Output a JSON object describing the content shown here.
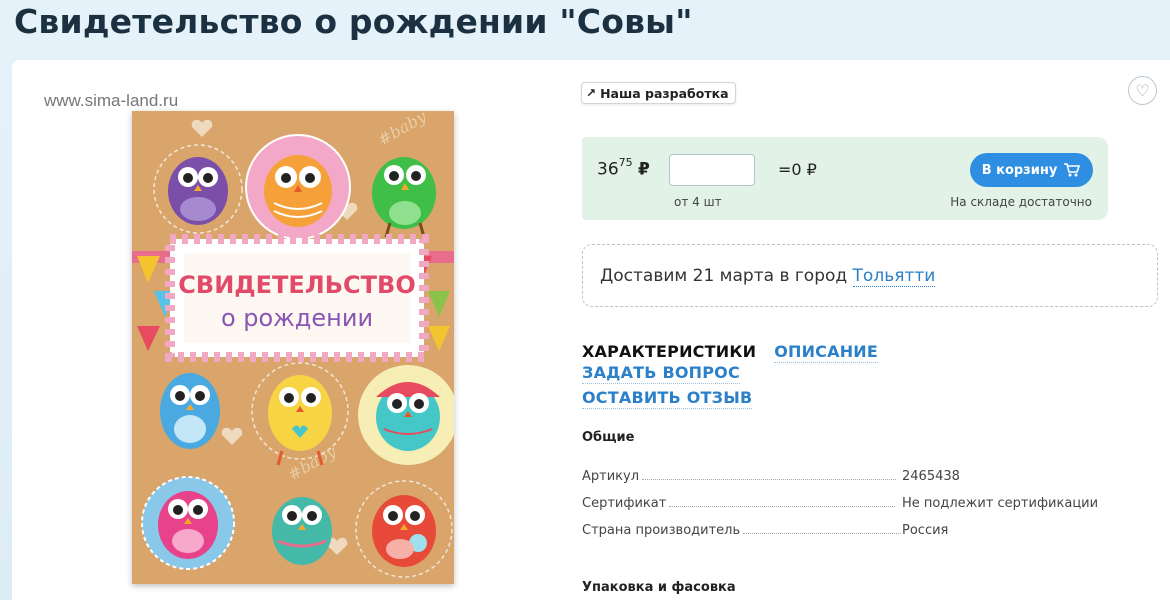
{
  "page": {
    "title": "Свидетельство о рождении \"Совы\"",
    "watermark": "www.sima-land.ru"
  },
  "image": {
    "card_title_line1": "СВИДЕТЕЛЬСТВО",
    "card_title_line2": "о рождении",
    "baby_text": "#baby"
  },
  "badge": {
    "icon": "arrow-curve-icon",
    "label": "Наша разработка"
  },
  "favorite": {
    "icon": "heart-icon"
  },
  "buy": {
    "price_main": "36",
    "price_cents": "75",
    "currency": "₽",
    "quantity_value": "",
    "total": "=0 ₽",
    "min_qty": "от 4 шт",
    "cart_label": "В корзину",
    "cart_icon": "cart-icon",
    "stock": "На складе достаточно",
    "accent_color": "#2e8fe2"
  },
  "delivery": {
    "text": "Доставим 21 марта в город ",
    "city": "Тольятти"
  },
  "tabs": [
    {
      "label": "ХАРАКТЕРИСТИКИ",
      "active": true
    },
    {
      "label": "ОПИСАНИЕ",
      "active": false
    },
    {
      "label": "ЗАДАТЬ ВОПРОС",
      "active": false
    },
    {
      "label": "ОСТАВИТЬ ОТЗЫВ",
      "active": false
    }
  ],
  "specs": {
    "general_title": "Общие",
    "rows": [
      {
        "label": "Артикул",
        "value": "2465438"
      },
      {
        "label": "Сертификат",
        "value": "Не подлежит сертификации"
      },
      {
        "label": "Страна производитель",
        "value": "Россия"
      }
    ],
    "packaging_title": "Упаковка и фасовка"
  }
}
